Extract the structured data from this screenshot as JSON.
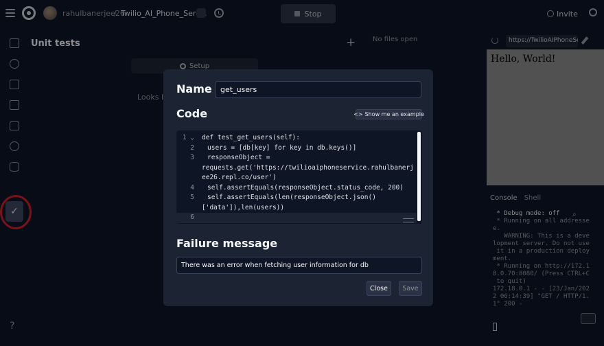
{
  "topbar": {
    "username": "rahulbanerjee26",
    "separator": "/",
    "repl_name": "Twilio_AI_Phone_Serv...",
    "stop_label": "Stop",
    "invite_label": "Invite"
  },
  "unit_tests": {
    "title": "Unit tests",
    "add_label": "+",
    "setup_label": "Setup",
    "empty_text": "Looks lik"
  },
  "editor": {
    "no_files": "No files open"
  },
  "webview": {
    "url": "https://TwilioAIPhoneSe",
    "content": "Hello, World!"
  },
  "console": {
    "tabs": [
      "Console",
      "Shell"
    ],
    "lines": [
      " * Debug mode: off",
      " * Running on all addresse",
      "e.",
      "   WARNING: This is a deve",
      "lopment server. Do not use",
      " it in a production deploy",
      "ment.",
      " * Running on http://172.1",
      "8.0.70:8080/ (Press CTRL+C",
      " to quit)",
      "172.18.0.1 - - [23/Jan/202",
      "2 06:14:39] \"GET / HTTP/1.",
      "1\" 200 -"
    ]
  },
  "rail": {
    "help_label": "?"
  },
  "modal": {
    "name_label": "Name",
    "name_value": "get_users",
    "code_label": "Code",
    "example_label": "Show me an example",
    "code_lines": [
      {
        "num": "1",
        "text": "def test_get_users(self):"
      },
      {
        "num": "",
        "text": "users = [db[key] for key in db.keys()]"
      },
      {
        "num": "3",
        "text": "responseObject ="
      },
      {
        "num": "",
        "text": "requests.get('https://twilioaiphoneservice.rahulbanerj"
      },
      {
        "num": "",
        "text": "ee26.repl.co/user')"
      },
      {
        "num": "4",
        "text": "self.assertEquals(responseObject.status_code, 200)"
      },
      {
        "num": "5",
        "text": "self.assertEquals(len(responseObject.json()"
      },
      {
        "num": "",
        "text": "['data']),len(users))"
      },
      {
        "num": "6",
        "text": ""
      }
    ],
    "line2_num": "2",
    "failure_label": "Failure message",
    "failure_value": "There was an error when fetching user information for db",
    "close_label": "Close",
    "save_label": "Save"
  }
}
